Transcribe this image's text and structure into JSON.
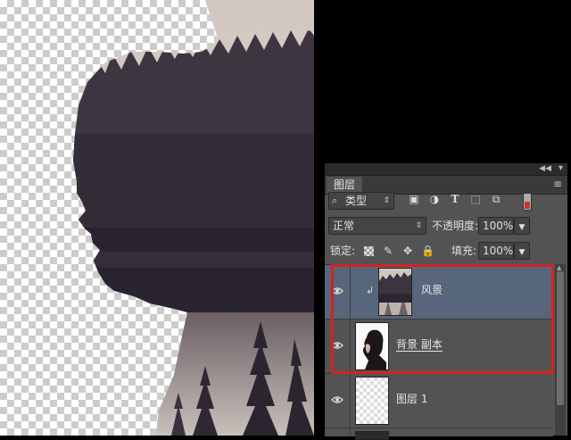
{
  "panel": {
    "tab_label": "图层",
    "collapse_icon": "double-chevron-right-icon",
    "close_icon": "close-icon",
    "menu_icon": "panel-menu-icon"
  },
  "filter": {
    "kind_label": "类型",
    "icons": [
      "pixel-filter-icon",
      "adjustment-filter-icon",
      "type-filter-icon",
      "shape-filter-icon",
      "smart-object-filter-icon"
    ]
  },
  "blending": {
    "mode": "正常",
    "opacity_label": "不透明度:",
    "opacity_value": "100%",
    "lock_label": "锁定:",
    "fill_label": "填充:",
    "fill_value": "100%"
  },
  "layers": [
    {
      "name": "风景",
      "visible": true,
      "selected": true,
      "clipped": true,
      "thumbnail": "forest-landscape"
    },
    {
      "name": "背景 副本",
      "visible": true,
      "selected": false,
      "clipped": false,
      "thumbnail": "woman-portrait"
    },
    {
      "name": "图层 1",
      "visible": true,
      "selected": false,
      "clipped": false,
      "thumbnail": "transparent"
    }
  ],
  "colors": {
    "panel_bg": "#535353",
    "selected_row": "#57667a",
    "highlight": "#d92020",
    "canvas_tone": "#c7bdb6",
    "forest": "#3a3240"
  }
}
